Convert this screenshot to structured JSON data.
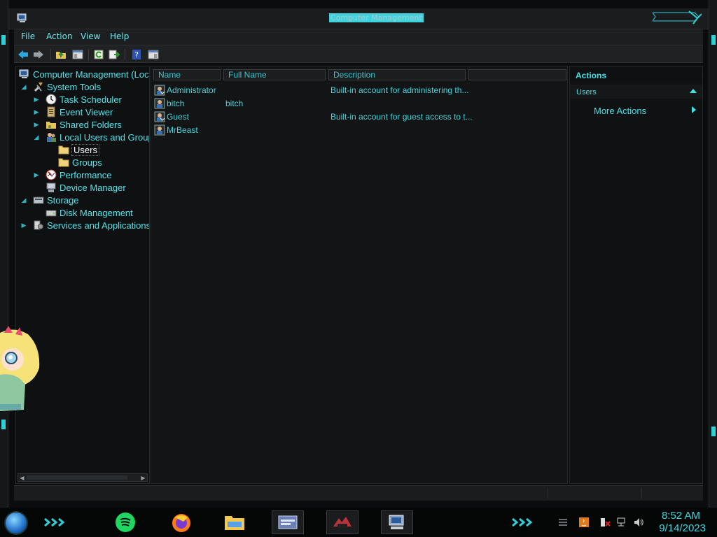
{
  "window": {
    "title": "Computer Management"
  },
  "menubar": {
    "items": [
      "File",
      "Action",
      "View",
      "Help"
    ]
  },
  "toolbar": {
    "icons": [
      "back-icon",
      "forward-icon",
      "up-folder-icon",
      "show-hide-console-tree-icon",
      "refresh-icon",
      "export-list-icon",
      "help-icon",
      "show-hide-action-pane-icon"
    ]
  },
  "tree": {
    "root": "Computer Management (Local)",
    "items": [
      {
        "label": "System Tools",
        "icon": "tools-icon"
      },
      {
        "label": "Task Scheduler",
        "icon": "clock-icon"
      },
      {
        "label": "Event Viewer",
        "icon": "event-viewer-icon"
      },
      {
        "label": "Shared Folders",
        "icon": "shared-folder-icon"
      },
      {
        "label": "Local Users and Groups",
        "icon": "users-icon"
      },
      {
        "label": "Users",
        "icon": "folder-icon"
      },
      {
        "label": "Groups",
        "icon": "folder-icon"
      },
      {
        "label": "Performance",
        "icon": "performance-icon"
      },
      {
        "label": "Device Manager",
        "icon": "device-manager-icon"
      },
      {
        "label": "Storage",
        "icon": "storage-icon"
      },
      {
        "label": "Disk Management",
        "icon": "disk-icon"
      },
      {
        "label": "Services and Applications",
        "icon": "services-icon"
      }
    ]
  },
  "list": {
    "columns": [
      "Name",
      "Full Name",
      "Description"
    ],
    "rows": [
      {
        "name": "Administrator",
        "full_name": "",
        "description": "Built-in account for administering th..."
      },
      {
        "name": "bitch",
        "full_name": "bitch",
        "description": ""
      },
      {
        "name": "Guest",
        "full_name": "",
        "description": "Built-in account for guest access to t..."
      },
      {
        "name": "MrBeast",
        "full_name": "",
        "description": ""
      }
    ]
  },
  "actions": {
    "header": "Actions",
    "section": "Users",
    "items": [
      "More Actions"
    ]
  },
  "taskbar": {
    "apps": [
      "spotify-icon",
      "firefox-icon",
      "file-explorer-icon",
      "control-panel-icon",
      "app-icon",
      "computer-management-icon"
    ],
    "clock_time": "8:52 AM",
    "clock_date": "9/14/2023"
  },
  "colors": {
    "accent": "#3fd7e0",
    "background": "#131415"
  }
}
